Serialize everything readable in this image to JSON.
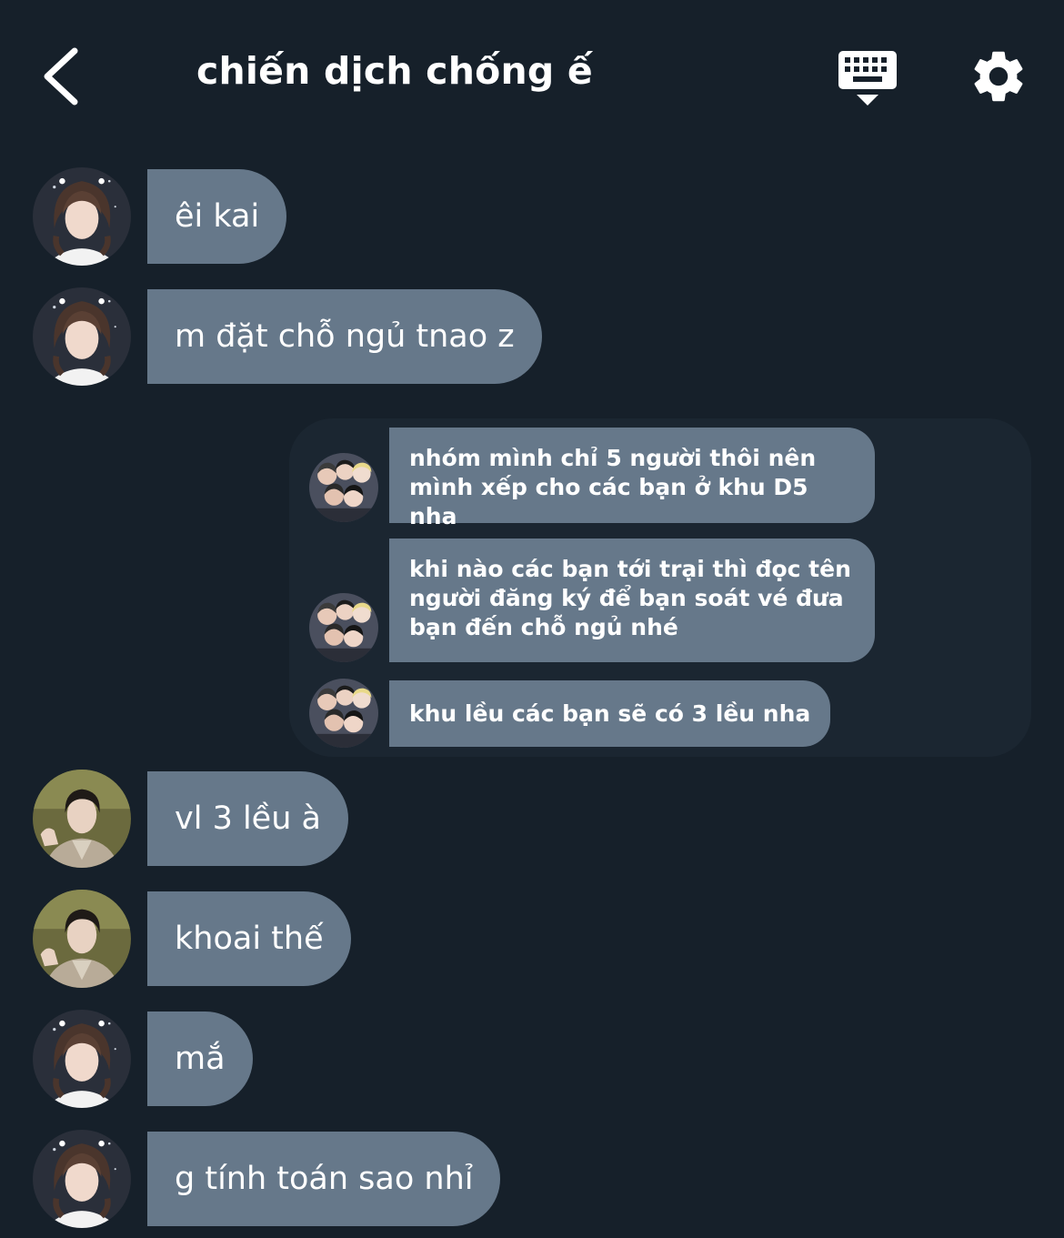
{
  "header": {
    "title": "chiến dịch chống ế",
    "back_icon": "chevron-left-icon",
    "keyboard_icon": "keyboard-hide-icon",
    "settings_icon": "gear-icon"
  },
  "colors": {
    "background": "#16202a",
    "panel": "#1b2631",
    "bubble": "#66788a",
    "text": "#ffffff"
  },
  "messages": [
    {
      "text": "êi kai"
    },
    {
      "text": "m đặt chỗ ngủ tnao z"
    },
    {
      "text": "nhóm mình chỉ 5 người thôi nên mình xếp cho các bạn ở khu D5 nha"
    },
    {
      "text": "khi nào các bạn tới trại thì đọc tên người đăng ký để bạn soát vé đưa bạn đến chỗ ngủ nhé"
    },
    {
      "text": "khu lều các bạn sẽ có 3 lều nha"
    },
    {
      "text": "vl 3 lều à"
    },
    {
      "text": "khoai thế"
    },
    {
      "text": "mắ"
    },
    {
      "text": "g tính toán sao nhỉ"
    }
  ]
}
